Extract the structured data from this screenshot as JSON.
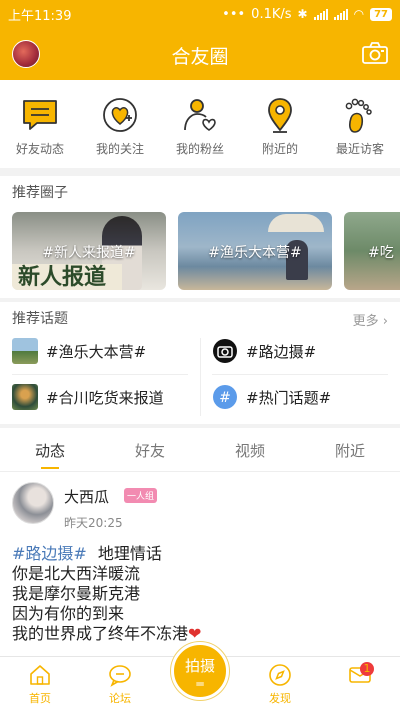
{
  "status_bar": {
    "time": "上午11:39",
    "dots": "•••",
    "speed": "0.1K/s",
    "battery": "77"
  },
  "header": {
    "title": "合友圈"
  },
  "quick_actions": [
    {
      "label": "好友动态",
      "icon": "chat-bubble-icon"
    },
    {
      "label": "我的关注",
      "icon": "heart-plus-icon"
    },
    {
      "label": "我的粉丝",
      "icon": "person-heart-icon"
    },
    {
      "label": "附近的",
      "icon": "location-pin-icon"
    },
    {
      "label": "最近访客",
      "icon": "footprints-icon"
    }
  ],
  "recommended_circles": {
    "title": "推荐圈子",
    "items": [
      {
        "label": "#新人来报道#",
        "sign_text": "新人报道"
      },
      {
        "label": "#渔乐大本营#"
      },
      {
        "label": "#吃"
      }
    ]
  },
  "recommended_topics": {
    "title": "推荐话题",
    "more": "更多",
    "items": [
      {
        "label": "#渔乐大本营#",
        "icon": "landscape-thumb"
      },
      {
        "label": "#路边摄#",
        "icon": "camera-thumb"
      },
      {
        "label": "#合川吃货来报道",
        "icon": "food-thumb"
      },
      {
        "label": "#热门话题#",
        "icon": "hashtag-icon"
      }
    ]
  },
  "tabs": [
    {
      "label": "动态",
      "active": true
    },
    {
      "label": "好友",
      "active": false
    },
    {
      "label": "视频",
      "active": false
    },
    {
      "label": "附近",
      "active": false
    }
  ],
  "post": {
    "author": "大西瓜",
    "badge": "一人组",
    "time": "昨天20:25",
    "tag": "#路边摄#",
    "first_line_text": "地理情话",
    "lines": [
      "你是北大西洋暖流",
      "我是摩尔曼斯克港",
      "因为有你的到来",
      "我的世界成了终年不冻港"
    ],
    "heart": "❤"
  },
  "bottom_nav": [
    {
      "label": "首页",
      "icon": "home-icon"
    },
    {
      "label": "论坛",
      "icon": "forum-icon"
    },
    {
      "label": "拍摄",
      "icon": "shoot-icon"
    },
    {
      "label": "发现",
      "icon": "compass-icon"
    },
    {
      "label": "",
      "icon": "mail-icon",
      "badge": "1"
    }
  ],
  "colors": {
    "brand": "#f7b500",
    "tag": "#4a7ab8",
    "badge": "#ee3b3b"
  }
}
